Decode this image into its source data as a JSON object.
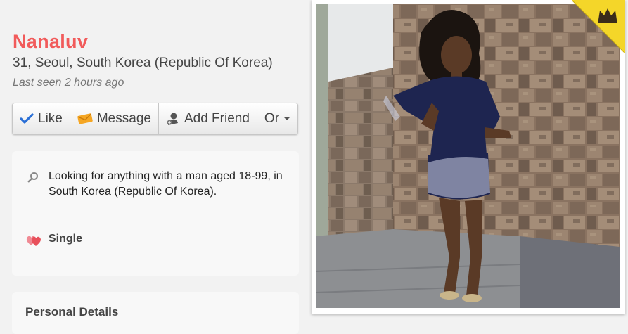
{
  "profile": {
    "name": "Nanaluv",
    "details": "31, Seoul, South Korea (Republic Of Korea)",
    "last_seen": "Last seen 2 hours ago"
  },
  "actions": {
    "like": "Like",
    "message": "Message",
    "add_friend": "Add Friend",
    "more": "Or"
  },
  "about": {
    "looking_for": "Looking for anything with a man aged 18-99, in South Korea (Republic Of Korea).",
    "relationship_status": "Single"
  },
  "sections": {
    "personal_details_title": "Personal Details"
  },
  "icons": {
    "like": "check-icon",
    "message": "envelope-icon",
    "add_friend": "person-add-icon",
    "more": "caret-down-icon",
    "looking": "search-icon",
    "status": "hearts-icon",
    "badge": "crown-icon"
  },
  "colors": {
    "name": "#f15b5b",
    "check": "#2a6fd6",
    "envelope": "#f5a623",
    "heart": "#e8505b",
    "badge": "#f4d629"
  }
}
